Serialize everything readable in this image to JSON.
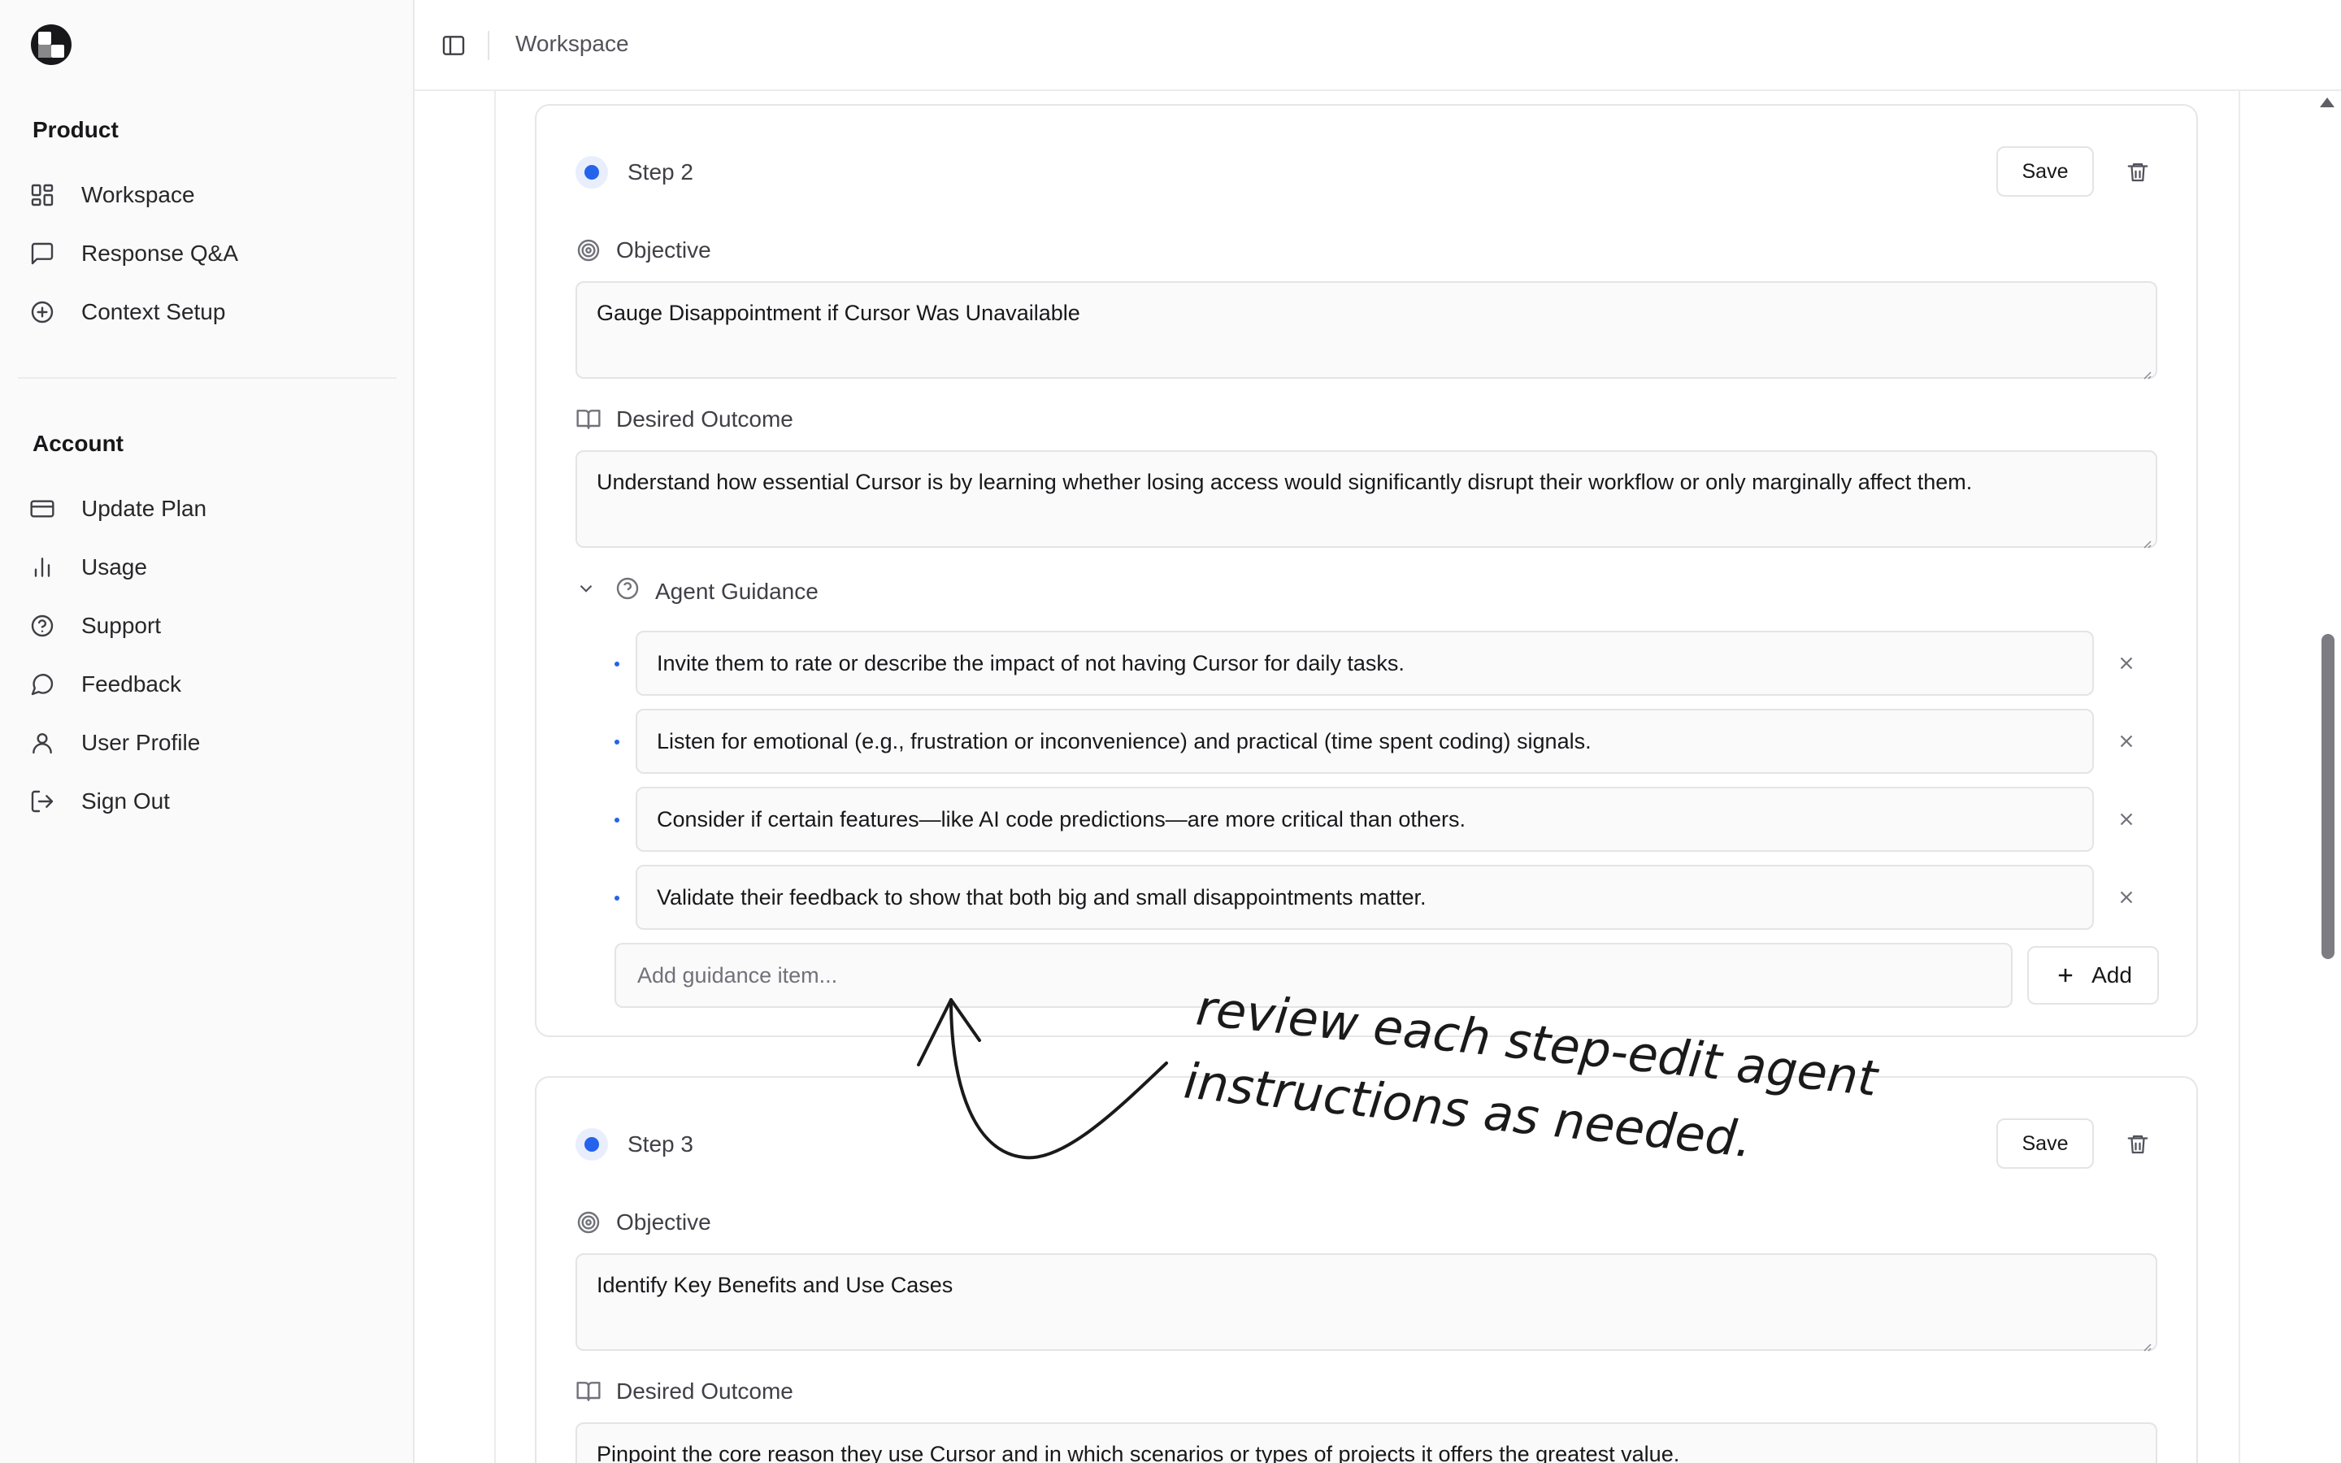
{
  "sidebar": {
    "product_label": "Product",
    "product_items": [
      {
        "label": "Workspace",
        "icon": "layout-grid-icon"
      },
      {
        "label": "Response Q&A",
        "icon": "message-square-icon"
      },
      {
        "label": "Context Setup",
        "icon": "plus-circle-icon"
      }
    ],
    "account_label": "Account",
    "account_items": [
      {
        "label": "Update Plan",
        "icon": "credit-card-icon"
      },
      {
        "label": "Usage",
        "icon": "bar-chart-icon"
      },
      {
        "label": "Support",
        "icon": "help-circle-icon"
      },
      {
        "label": "Feedback",
        "icon": "message-circle-icon"
      },
      {
        "label": "User Profile",
        "icon": "user-icon"
      },
      {
        "label": "Sign Out",
        "icon": "log-out-icon"
      }
    ]
  },
  "header": {
    "breadcrumb": "Workspace"
  },
  "labels": {
    "objective": "Objective",
    "desired_outcome": "Desired Outcome",
    "agent_guidance": "Agent Guidance",
    "save": "Save",
    "add": "Add",
    "add_placeholder": "Add guidance item..."
  },
  "steps": [
    {
      "title": "Step 2",
      "objective": "Gauge Disappointment if Cursor Was Unavailable",
      "desired_outcome": "Understand how essential Cursor is by learning whether losing access would significantly disrupt their workflow or only marginally affect them.",
      "guidance": [
        "Invite them to rate or describe the impact of not having Cursor for daily tasks.",
        "Listen for emotional (e.g., frustration or inconvenience) and practical (time spent coding) signals.",
        "Consider if certain features—like AI code predictions—are more critical than others.",
        "Validate their feedback to show that both big and small disappointments matter."
      ]
    },
    {
      "title": "Step 3",
      "objective": "Identify Key Benefits and Use Cases",
      "desired_outcome": "Pinpoint the core reason they use Cursor and in which scenarios or types of projects it offers the greatest value."
    }
  ],
  "annotation": {
    "line1": "review each step-edit agent",
    "line2": "instructions as needed."
  },
  "colors": {
    "accent": "#2563eb",
    "border": "#e4e4e7",
    "sidebar_bg": "#fafafa"
  }
}
